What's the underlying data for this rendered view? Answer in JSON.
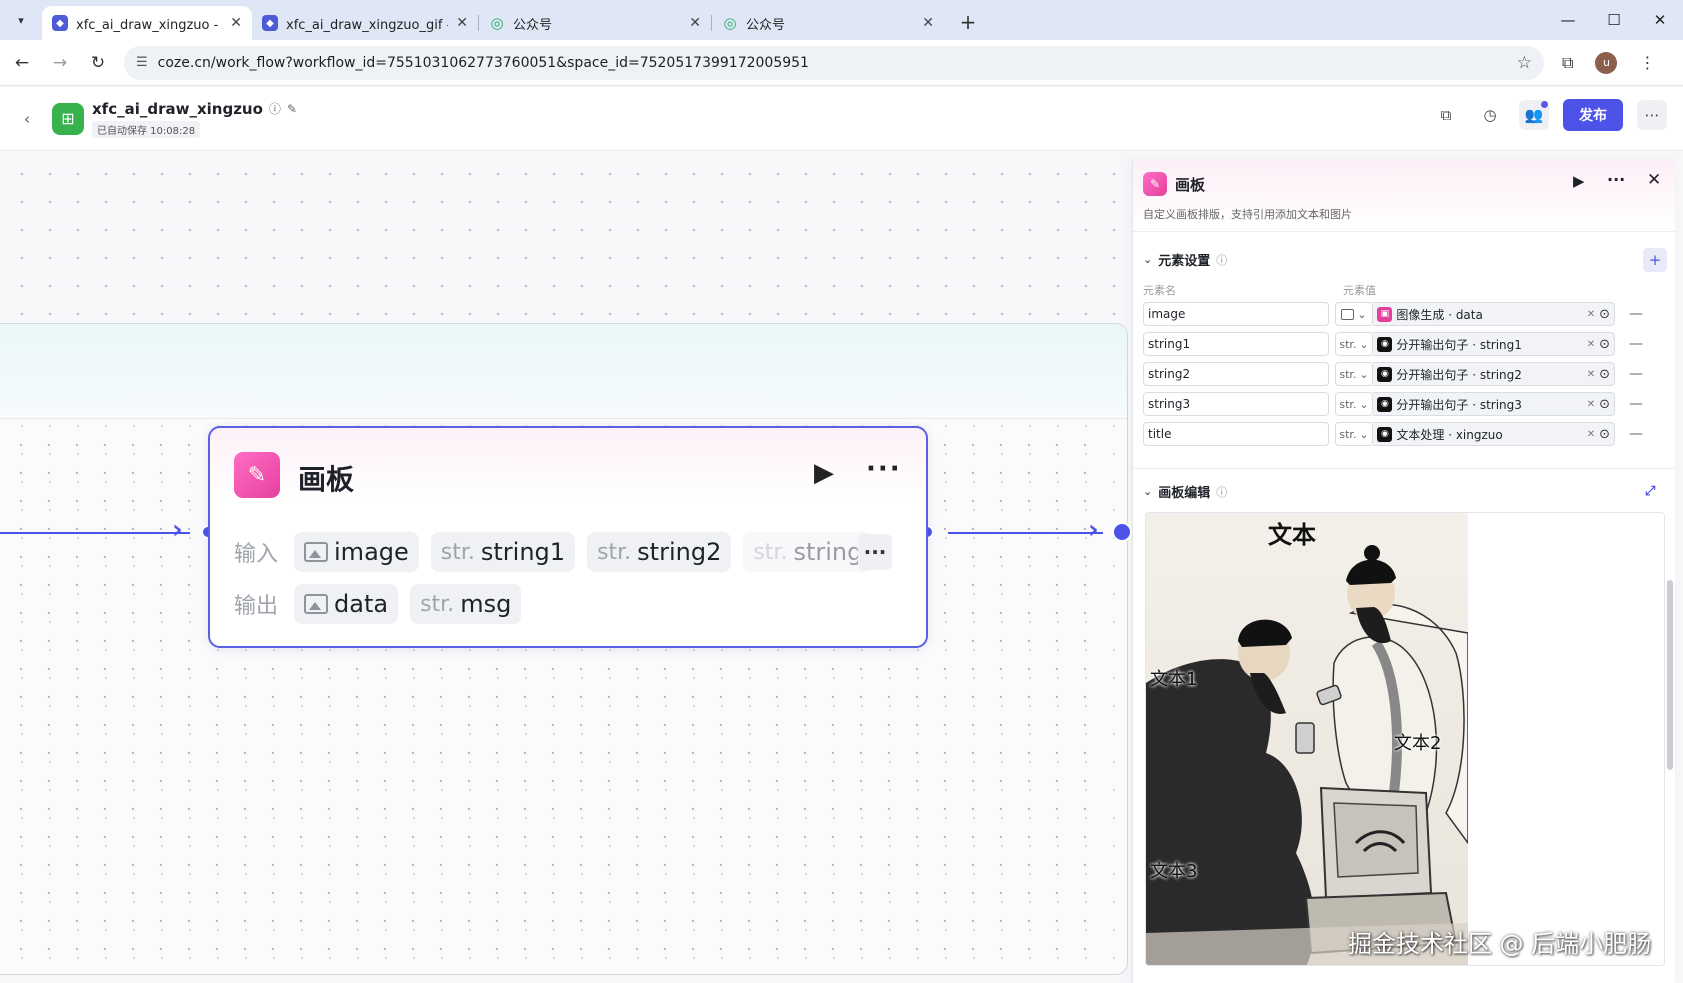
{
  "browser": {
    "tabs": [
      {
        "label": "xfc_ai_draw_xingzuo - 工作流",
        "icon": "coze",
        "active": true
      },
      {
        "label": "xfc_ai_draw_xingzuo_gif - 工作",
        "icon": "coze",
        "active": false
      },
      {
        "label": "公众号",
        "icon": "wechat",
        "active": false
      },
      {
        "label": "公众号",
        "icon": "wechat",
        "active": false
      }
    ],
    "url": "coze.cn/work_flow?workflow_id=7551031062773760051&space_id=7520517399172005951",
    "avatar_letter": "u"
  },
  "app": {
    "title": "xfc_ai_draw_xingzuo",
    "saved": "已自动保存 10:08:28",
    "publish_label": "发布"
  },
  "node": {
    "title": "画板",
    "input_label": "输入",
    "output_label": "输出",
    "inputs": [
      {
        "type": "image",
        "name": "image"
      },
      {
        "type": "str.",
        "name": "string1"
      },
      {
        "type": "str.",
        "name": "string2"
      },
      {
        "type": "str.",
        "name": "string"
      }
    ],
    "outputs": [
      {
        "type": "image",
        "name": "data"
      },
      {
        "type": "str.",
        "name": "msg"
      }
    ]
  },
  "panel": {
    "title": "画板",
    "description": "自定义画板排版，支持引用添加文本和图片",
    "elements_section": "元素设置",
    "col_name": "元素名",
    "col_value": "元素值",
    "elements": [
      {
        "name": "image",
        "type": "image",
        "value": "图像生成 · data",
        "icon": "pink"
      },
      {
        "name": "string1",
        "type": "str.",
        "value": "分开输出句子 · string1",
        "icon": "black"
      },
      {
        "name": "string2",
        "type": "str.",
        "value": "分开输出句子 · string2",
        "icon": "black"
      },
      {
        "name": "string3",
        "type": "str.",
        "value": "分开输出句子 · string3",
        "icon": "black"
      },
      {
        "name": "title",
        "type": "str.",
        "value": "文本处理 · xingzuo",
        "icon": "black"
      }
    ],
    "canvas_section": "画板编辑",
    "artboard": {
      "title_text": "文本",
      "text1": "文本1",
      "text2": "文本2",
      "text3": "文本3"
    }
  },
  "watermark": "掘金技术社区 @ 后端小肥肠"
}
